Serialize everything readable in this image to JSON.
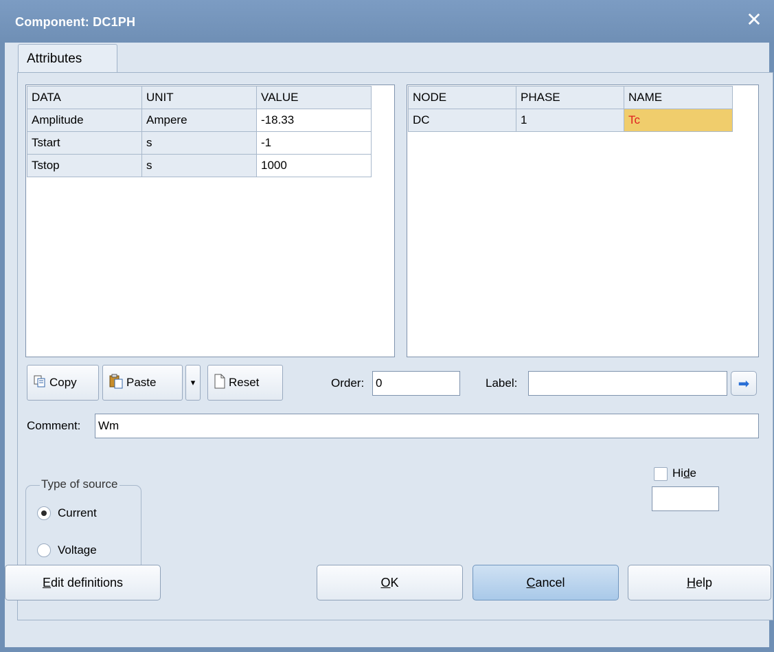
{
  "window": {
    "title": "Component: DC1PH",
    "close_glyph": "✕"
  },
  "tabs": [
    {
      "label": "Attributes"
    }
  ],
  "data_grid": {
    "headers": [
      "DATA",
      "UNIT",
      "VALUE"
    ],
    "rows": [
      [
        "Amplitude",
        "Ampere",
        "-18.33"
      ],
      [
        "Tstart",
        "s",
        "-1"
      ],
      [
        "Tstop",
        "s",
        "1000"
      ]
    ]
  },
  "node_grid": {
    "headers": [
      "NODE",
      "PHASE",
      "NAME"
    ],
    "rows": [
      [
        "DC",
        "1",
        "Tc"
      ]
    ]
  },
  "toolbar": {
    "copy_label": "Copy",
    "paste_label": "Paste",
    "reset_label": "Reset",
    "dropdown_glyph": "▾"
  },
  "order": {
    "label": "Order:",
    "value": "0"
  },
  "label_field": {
    "label": "Label:",
    "value": "",
    "go_glyph": "➡"
  },
  "comment": {
    "label": "Comment:",
    "value": "Wm"
  },
  "source_type": {
    "title": "Type of source",
    "options": [
      "Current",
      "Voltage"
    ],
    "selected": "Current"
  },
  "hide": {
    "label_pre": "Hi",
    "label_underlined": "d",
    "label_post": "e",
    "checked": false,
    "value": ""
  },
  "footer": {
    "edit_definitions": {
      "u": "E",
      "rest": "dit definitions"
    },
    "ok": {
      "u": "O",
      "rest": "K"
    },
    "cancel": {
      "u": "C",
      "rest": "ancel"
    },
    "help": {
      "u": "H",
      "rest": "elp"
    }
  },
  "colors": {
    "title_bar": "#6f8fb5",
    "selected_cell": "#f0cd6c",
    "selected_text": "#e02020",
    "panel": "#dde6f0"
  }
}
